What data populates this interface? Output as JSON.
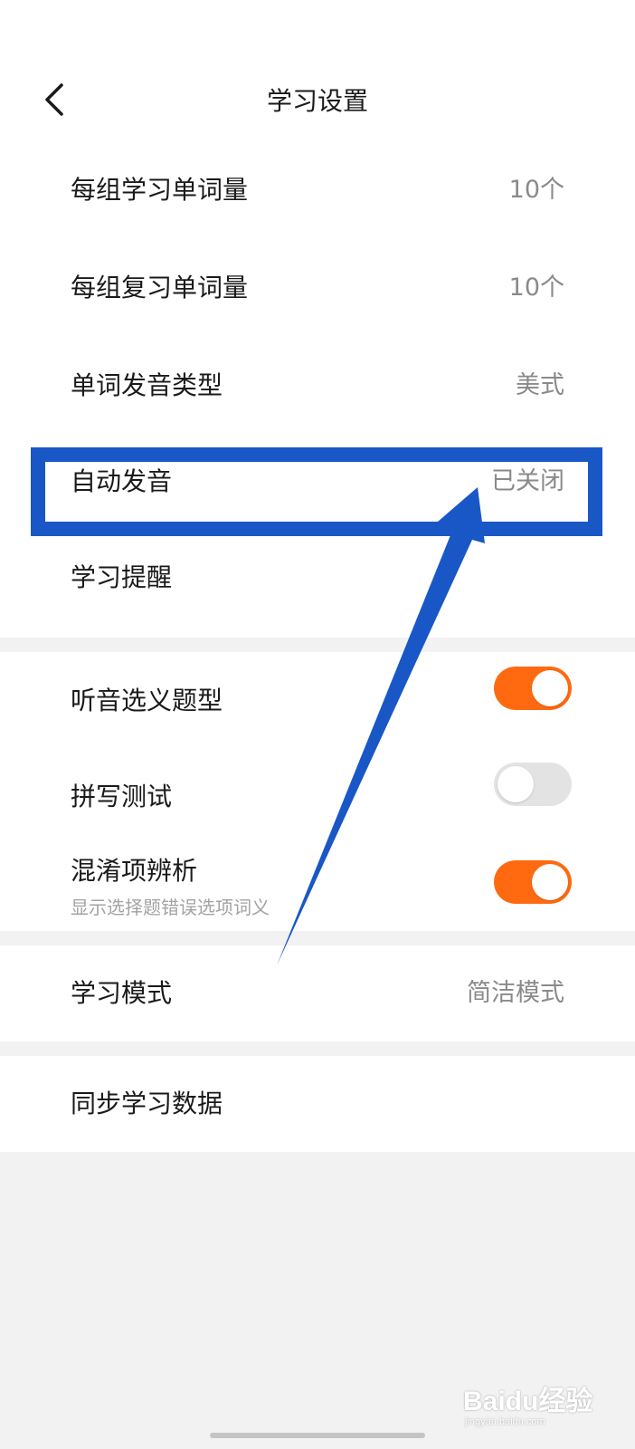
{
  "header": {
    "title": "学习设置",
    "back_icon": "chevron-left-icon"
  },
  "settings_group1": [
    {
      "label": "每组学习单词量",
      "value": "10个"
    },
    {
      "label": "每组复习单词量",
      "value": "10个"
    },
    {
      "label": "单词发音类型",
      "value": "美式"
    },
    {
      "label": "自动发音",
      "value": "已关闭"
    },
    {
      "label": "学习提醒",
      "value": ""
    }
  ],
  "settings_group2": [
    {
      "label": "听音选义题型",
      "toggle": true
    },
    {
      "label": "拼写测试",
      "toggle": false
    },
    {
      "label": "混淆项辨析",
      "sublabel": "显示选择题错误选项词义",
      "toggle": true
    }
  ],
  "settings_group3": {
    "label": "学习模式",
    "value": "简洁模式"
  },
  "settings_group4": {
    "label": "同步学习数据"
  },
  "watermark": {
    "brand": "Baidu经验",
    "domain": "jingyan.baidu.com"
  },
  "colors": {
    "toggle_on": "#ff6a10",
    "toggle_off": "#e3e3e3",
    "annotation_blue": "#1a57c6",
    "value_gray": "#8a8a8a"
  }
}
